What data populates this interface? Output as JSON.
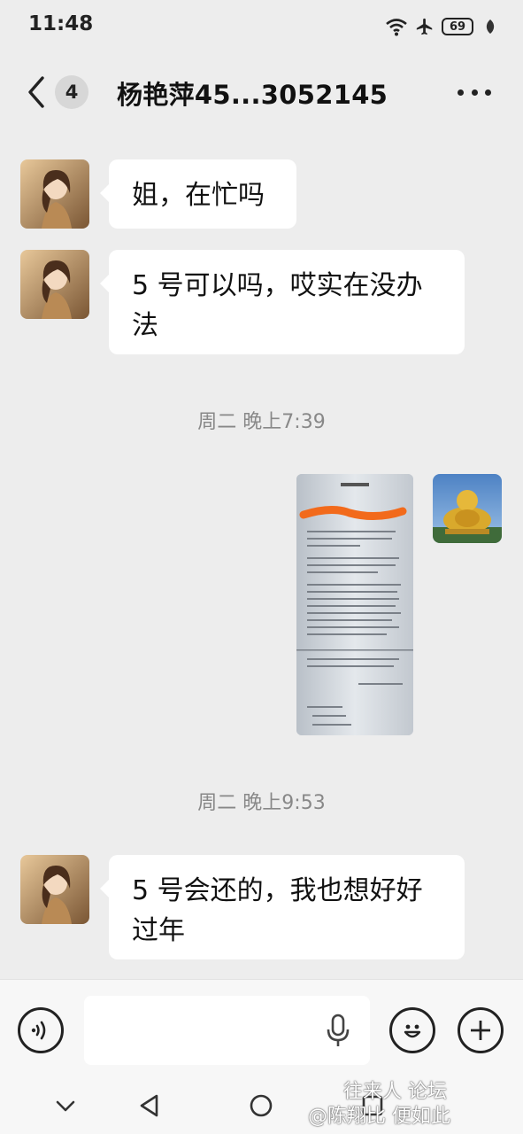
{
  "status_bar": {
    "time": "11:48",
    "battery": "69",
    "icons": [
      "wifi-icon",
      "airplane-icon",
      "battery-icon",
      "leaf-icon"
    ]
  },
  "header": {
    "unread_count": "4",
    "title": "杨艳萍45...3052145"
  },
  "messages": [
    {
      "type": "text",
      "side": "left",
      "text": "姐，在忙吗"
    },
    {
      "type": "text",
      "side": "left",
      "text": "5 号可以吗，哎实在没办法"
    },
    {
      "type": "timestamp",
      "text": "周二 晚上7:39"
    },
    {
      "type": "image",
      "side": "right",
      "description_icon": "document-photo"
    },
    {
      "type": "timestamp",
      "text": "周二 晚上9:53"
    },
    {
      "type": "text",
      "side": "left",
      "text": "5 号会还的，我也想好好过年"
    }
  ],
  "input_bar": {
    "icons": [
      "voice-icon",
      "microphone-icon",
      "emoji-icon",
      "plus-icon"
    ],
    "value": ""
  },
  "nav_bar": {
    "icons": [
      "chevron-down-icon",
      "back-triangle-icon",
      "home-circle-icon",
      "recent-square-icon"
    ]
  },
  "watermark": {
    "line1": "往来人 论坛",
    "line2": "@陈翔比 便如此"
  },
  "colors": {
    "background": "#ededed",
    "bubble": "#ffffff",
    "timestamp": "#888888"
  }
}
